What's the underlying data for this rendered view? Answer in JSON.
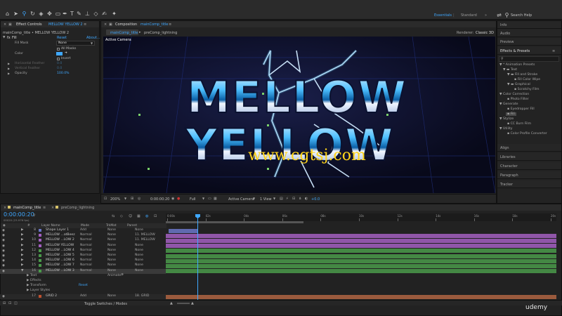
{
  "toolbar": {
    "workspaces": [
      "Essentials",
      "Standard"
    ],
    "active_workspace": "Essentials",
    "search_placeholder": "Search Help"
  },
  "effect_controls": {
    "tab_label": "Effect Controls",
    "tab_layer": "MELLOW YELLOW 2",
    "breadcrumb": "mainComp_title • MELLOW YELLOW 2",
    "effect_name": "Fill",
    "reset": "Reset",
    "about": "About...",
    "rows": [
      {
        "label": "Fill Mask",
        "value": "None"
      },
      {
        "label": "",
        "value": "All Masks"
      },
      {
        "label": "Color",
        "value": ""
      },
      {
        "label": "",
        "value": "Invert"
      },
      {
        "label": "Horizontal Feather",
        "value": "0.0"
      },
      {
        "label": "Vertical Feather",
        "value": "0.0"
      },
      {
        "label": "Opacity",
        "value": "100.0%"
      }
    ],
    "fill_color": "#3fa8ff"
  },
  "composition": {
    "tab_label": "Composition",
    "tab_name": "mainComp_title",
    "subtabs": [
      "mainComp_title",
      "preComp_lightning"
    ],
    "renderer_label": "Renderer:",
    "renderer": "Classic 3D",
    "camera_label": "Active Camera",
    "title_line1": "MELLOW",
    "title_line2": "YELLOW",
    "watermark": "www.cgtsj.com",
    "footer": {
      "zoom": "200%",
      "timecode": "0:00:00:20",
      "resolution": "Full",
      "view": "Active Camera",
      "views": "1 View",
      "exposure": "+0.0"
    }
  },
  "right_panel": {
    "sections_top": [
      "Info",
      "Audio",
      "Preview"
    ],
    "effects_title": "Effects & Presets",
    "tree": [
      {
        "label": "* Animation Presets",
        "indent": 0
      },
      {
        "label": "Text",
        "indent": 1
      },
      {
        "label": "Fill and Stroke",
        "indent": 2
      },
      {
        "label": "Fill Color Wipe",
        "indent": 3
      },
      {
        "label": "Graphical",
        "indent": 2
      },
      {
        "label": "Scratchy Film",
        "indent": 3
      },
      {
        "label": "Color Correction",
        "indent": 0
      },
      {
        "label": "Photo Filter",
        "indent": 1
      },
      {
        "label": "Generate",
        "indent": 0
      },
      {
        "label": "Eyedropper Fill",
        "indent": 1
      },
      {
        "label": "Fill",
        "indent": 1
      },
      {
        "label": "Stylize",
        "indent": 0
      },
      {
        "label": "CC Burn Film",
        "indent": 1
      },
      {
        "label": "Utility",
        "indent": 0
      },
      {
        "label": "Color Profile Converter",
        "indent": 1
      }
    ],
    "sections_bottom": [
      "Align",
      "Libraries",
      "Character",
      "Paragraph",
      "Tracker"
    ]
  },
  "timeline": {
    "tabs": [
      "mainComp_title",
      "preComp_lightning"
    ],
    "timecode": "0:00:00:20",
    "fps": "00020 (23.976 fps)",
    "headers": {
      "num": "#",
      "name": "Layer Name",
      "mode": "Mode",
      "trkmat": "TrkMat",
      "parent": "Parent"
    },
    "ruler": [
      "0:00s",
      "02s",
      "04s",
      "06s",
      "08s",
      "10s",
      "12s",
      "14s",
      "16s",
      "18s",
      "20s"
    ],
    "layers": [
      {
        "num": "8",
        "name": "Shape Layer 1",
        "mode": "Add",
        "trkmat": "None",
        "parent": "None",
        "color": "#6b77c9"
      },
      {
        "num": "9",
        "name": "MELLOW ...atBeez",
        "mode": "Normal",
        "trkmat": "None",
        "parent": "11. MELLOW",
        "color": "#a35fc1"
      },
      {
        "num": "10",
        "name": "MELLOW ...LOW 2",
        "mode": "Normal",
        "trkmat": "None",
        "parent": "11. MELLOW",
        "color": "#a35fc1"
      },
      {
        "num": "11",
        "name": "MELLOW YELLOW",
        "mode": "Normal",
        "trkmat": "None",
        "parent": "None",
        "color": "#a35fc1"
      },
      {
        "num": "12",
        "name": "MELLOW ...LOW 4",
        "mode": "Normal",
        "trkmat": "None",
        "parent": "None",
        "color": "#4a9a4a"
      },
      {
        "num": "13",
        "name": "MELLOW ...LOW 5",
        "mode": "Normal",
        "trkmat": "None",
        "parent": "None",
        "color": "#4a9a4a"
      },
      {
        "num": "14",
        "name": "MELLOW ...LOW 6",
        "mode": "Normal",
        "trkmat": "None",
        "parent": "None",
        "color": "#4a9a4a"
      },
      {
        "num": "15",
        "name": "MELLOW ...LOW 7",
        "mode": "Normal",
        "trkmat": "None",
        "parent": "None",
        "color": "#4a9a4a"
      },
      {
        "num": "16",
        "name": "MELLOW ...LOW 3",
        "mode": "Normal",
        "trkmat": "None",
        "parent": "None",
        "color": "#4a9a4a"
      }
    ],
    "sublayers": [
      "Text",
      "Effects",
      "Transform",
      "Layer Styles"
    ],
    "animate_label": "Animate:",
    "transform_reset": "Reset",
    "last_layer": {
      "num": "17",
      "name": "GRID 2",
      "mode": "Add",
      "trkmat": "None",
      "parent": "18. GRID",
      "color": "#c0512f"
    },
    "toggle_label": "Toggle Switches / Modes"
  },
  "branding": "udemy"
}
